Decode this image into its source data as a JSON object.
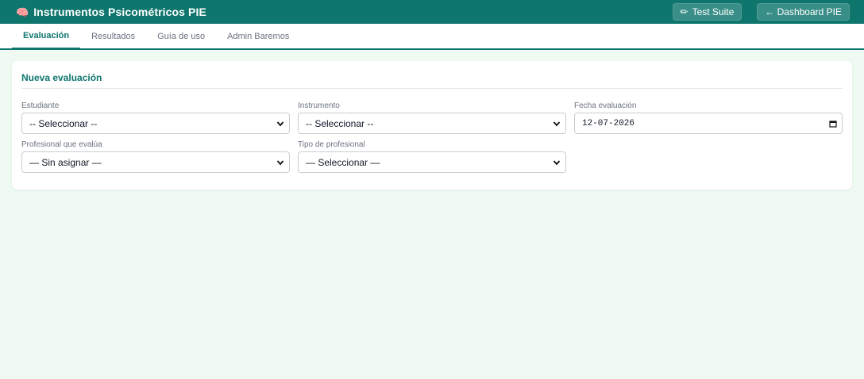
{
  "header": {
    "brand_icon": "🧠",
    "title": "Instrumentos Psicométricos PIE",
    "test_suite_icon": "✏",
    "test_suite_label": "Test Suite",
    "dashboard_label": "← Dashboard PIE"
  },
  "tabs": [
    {
      "label": "Evaluación",
      "active": true
    },
    {
      "label": "Resultados"
    },
    {
      "label": "Guía de uso"
    },
    {
      "label": "Admin Baremos"
    }
  ],
  "card": {
    "title": "Nueva evaluación",
    "fields": {
      "estudiante": {
        "label": "Estudiante",
        "value": "-- Seleccionar --"
      },
      "instrumento": {
        "label": "Instrumento",
        "value": "-- Seleccionar --"
      },
      "fecha": {
        "label": "Fecha evaluación",
        "value": "12-07-2026"
      },
      "profesional": {
        "label": "Profesional que evalúa",
        "value": "— Sin asignar —"
      },
      "tipo_profesional": {
        "label": "Tipo de profesional",
        "value": "— Seleccionar —"
      }
    }
  },
  "colors": {
    "accent": "#0f766e",
    "background": "#effaf2"
  }
}
